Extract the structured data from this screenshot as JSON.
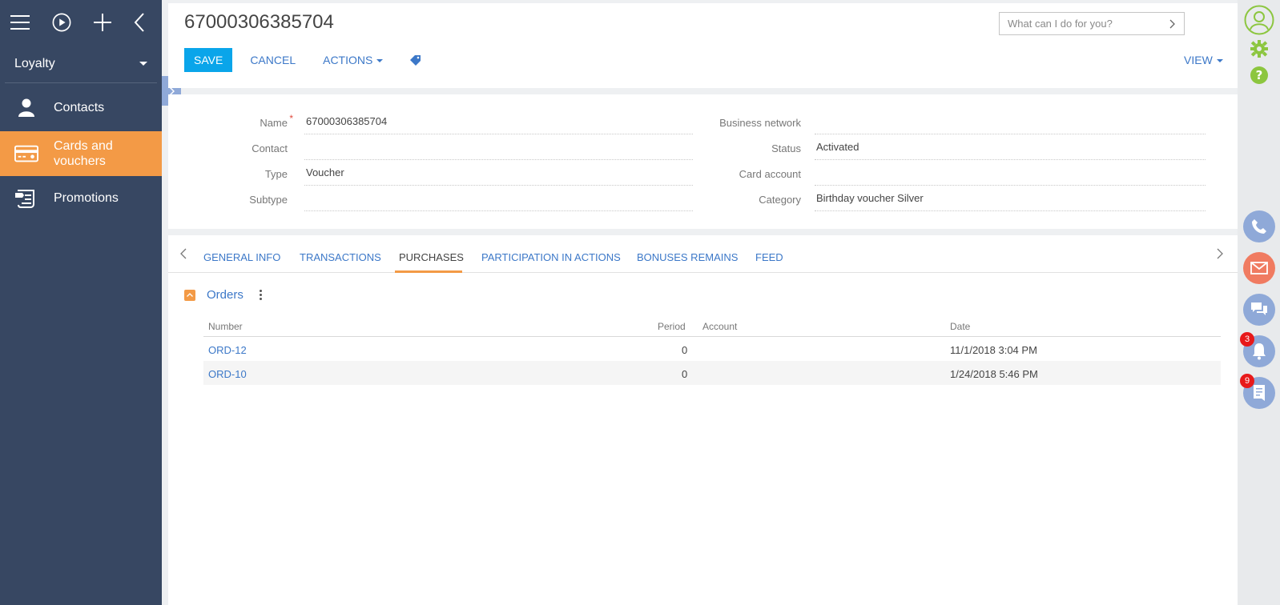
{
  "sidebar": {
    "section": "Loyalty",
    "items": [
      {
        "label": "Contacts"
      },
      {
        "label": "Cards and vouchers"
      },
      {
        "label": "Promotions"
      }
    ]
  },
  "header": {
    "title": "67000306385704",
    "search_placeholder": "What can I do for you?",
    "save_label": "SAVE",
    "cancel_label": "CANCEL",
    "actions_label": "ACTIONS",
    "view_label": "VIEW"
  },
  "fields": {
    "name_label": "Name",
    "name_value": "67000306385704",
    "contact_label": "Contact",
    "contact_value": "",
    "type_label": "Type",
    "type_value": "Voucher",
    "subtype_label": "Subtype",
    "subtype_value": "",
    "business_network_label": "Business network",
    "business_network_value": "",
    "status_label": "Status",
    "status_value": "Activated",
    "card_account_label": "Card account",
    "card_account_value": "",
    "category_label": "Category",
    "category_value": "Birthday voucher Silver"
  },
  "tabs": [
    {
      "label": "GENERAL INFO"
    },
    {
      "label": "TRANSACTIONS"
    },
    {
      "label": "PURCHASES"
    },
    {
      "label": "PARTICIPATION IN ACTIONS"
    },
    {
      "label": "BONUSES REMAINS"
    },
    {
      "label": "FEED"
    }
  ],
  "orders": {
    "title": "Orders",
    "columns": [
      "Number",
      "Period",
      "Account",
      "Date"
    ],
    "rows": [
      {
        "number": "ORD-12",
        "period": "0",
        "account": "",
        "date": "11/1/2018 3:04 PM"
      },
      {
        "number": "ORD-10",
        "period": "0",
        "account": "",
        "date": "1/24/2018 5:46 PM"
      }
    ]
  },
  "rightbar": {
    "notifications_count": "3",
    "feed_count": "9"
  },
  "colors": {
    "sidebar_bg": "#374762",
    "active_item": "#f39a46",
    "save_button": "#0aa5ea",
    "link_blue": "#3c78c8",
    "phone": "#8fa9d8",
    "email": "#f07b61",
    "badge": "#e8191a",
    "settings_green": "#8cc63f"
  }
}
